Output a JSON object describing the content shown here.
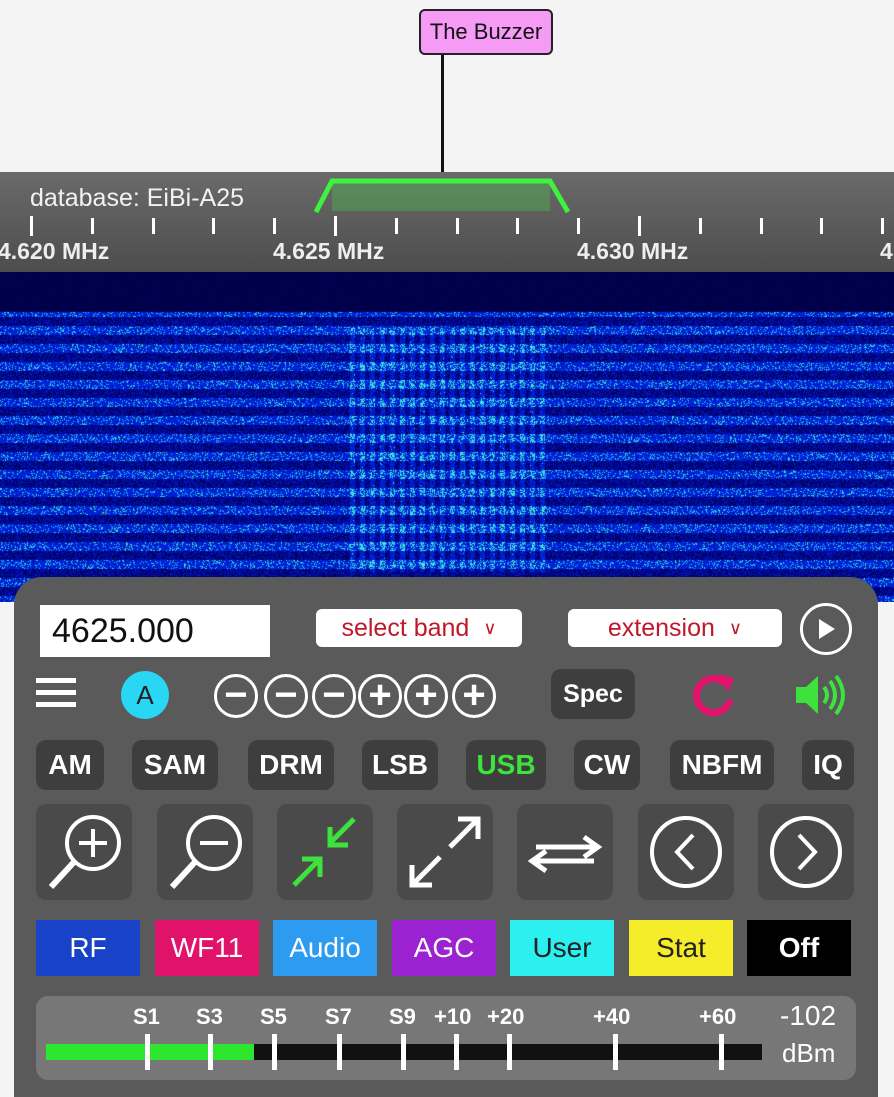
{
  "label": {
    "station": "The Buzzer"
  },
  "scale": {
    "database": "database: EiBi-A25",
    "freq_labels": [
      "4.620 MHz",
      "4.625 MHz",
      "4.630 MHz"
    ]
  },
  "panel": {
    "frequency": "4625.000",
    "band_select": "select band",
    "extension_select": "extension",
    "a_button": "A",
    "spec_button": "Spec",
    "modes": [
      {
        "label": "AM",
        "active": false
      },
      {
        "label": "SAM",
        "active": false
      },
      {
        "label": "DRM",
        "active": false
      },
      {
        "label": "LSB",
        "active": false
      },
      {
        "label": "USB",
        "active": true
      },
      {
        "label": "CW",
        "active": false
      },
      {
        "label": "NBFM",
        "active": false
      },
      {
        "label": "IQ",
        "active": false
      }
    ],
    "sliders": [
      {
        "label": "RF",
        "bg": "#1842c8",
        "fg": "#ffffff"
      },
      {
        "label": "WF11",
        "bg": "#e0126a",
        "fg": "#ffffff"
      },
      {
        "label": "Audio",
        "bg": "#2d9cf0",
        "fg": "#ffffff"
      },
      {
        "label": "AGC",
        "bg": "#9b22d0",
        "fg": "#ffffff"
      },
      {
        "label": "User",
        "bg": "#2cf0f0",
        "fg": "#222222"
      },
      {
        "label": "Stat",
        "bg": "#f5ec2a",
        "fg": "#222222"
      },
      {
        "label": "Off",
        "bg": "#000000",
        "fg": "#ffffff"
      }
    ]
  },
  "smeter": {
    "labels": [
      "S1",
      "S3",
      "S5",
      "S7",
      "S9",
      "+10",
      "+20",
      "+40",
      "+60"
    ],
    "value": "-102",
    "unit": "dBm",
    "level_fraction": 0.29
  },
  "colors": {
    "active_mode": "#3de23d",
    "passband": "#3ef23e",
    "refresh_icon": "#e0126a",
    "speaker_icon": "#3de23d",
    "a_button": "#29d6f3"
  }
}
